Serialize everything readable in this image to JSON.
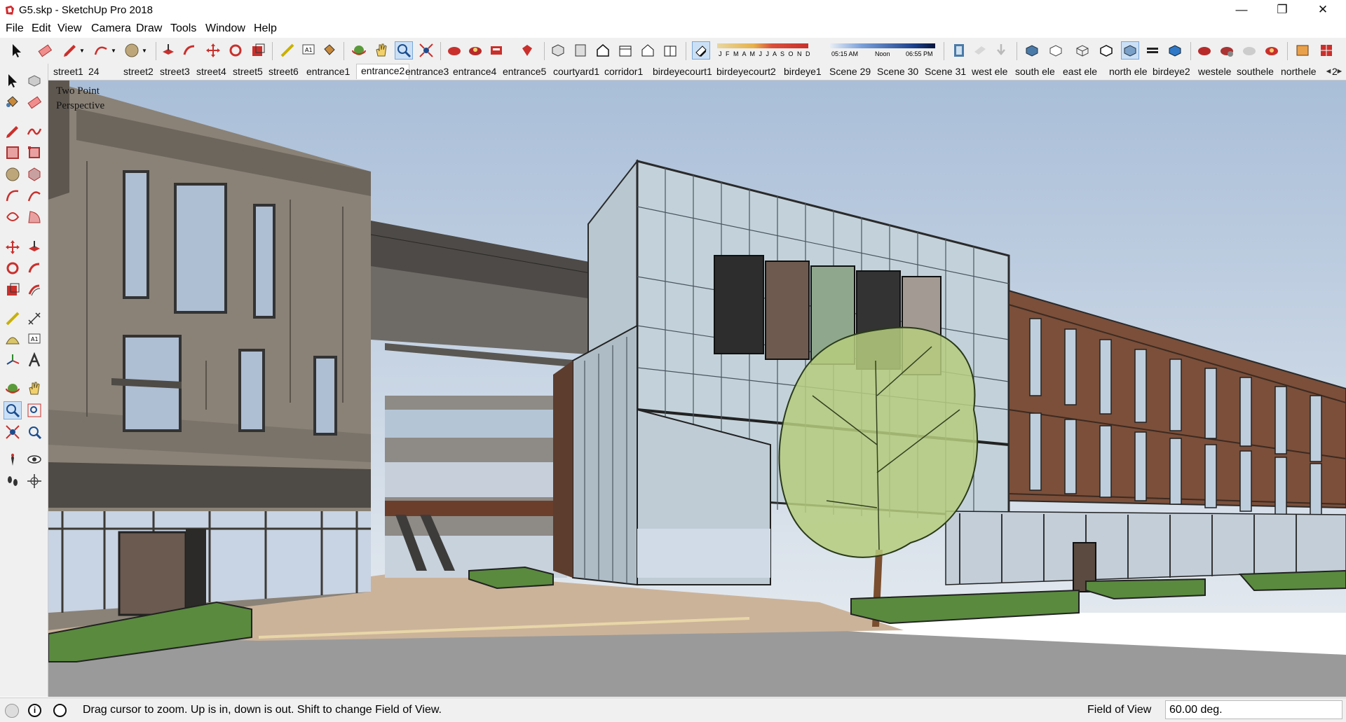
{
  "window": {
    "title": "G5.skp - SketchUp Pro 2018",
    "minimize_glyph": "—",
    "maximize_glyph": "❐",
    "close_glyph": "✕"
  },
  "menu": [
    "File",
    "Edit",
    "View",
    "Camera",
    "Draw",
    "Tools",
    "Window",
    "Help"
  ],
  "shadow_months": "J F M A M J J A S O N D",
  "time_bar": {
    "start": "05:15 AM",
    "mid": "Noon",
    "end": "06:55 PM"
  },
  "scenes": {
    "tabs": [
      "street1",
      "24",
      "street2",
      "street3",
      "street4",
      "street5",
      "street6",
      "entrance1",
      "entrance2",
      "entrance3",
      "entrance4",
      "entrance5",
      "courtyard1",
      "corridor1",
      "birdeyecourt1",
      "birdeyecourt2",
      "birdeye1",
      "Scene 29",
      "Scene 30",
      "Scene 31",
      "west ele",
      "south ele",
      "east ele",
      "north ele",
      "birdeye2",
      "westele",
      "southele",
      "northele",
      "2"
    ],
    "active": "entrance2",
    "scroll_left": "◄",
    "scroll_right": "►"
  },
  "viewport": {
    "camera_label_line1": "Two Point",
    "camera_label_line2": "Perspective"
  },
  "status": {
    "hint": "Drag cursor to zoom.  Up is in, down is out. Shift to change Field of View.",
    "measure_label": "Field of View",
    "measure_value": "60.00 deg."
  },
  "colors": {
    "sky_top": "#a9bed8",
    "sky_bottom": "#e2e8ee",
    "ground": "#8d8d8d",
    "stone_building": "#8a8277",
    "brick_building": "#7b4f3a",
    "glass": "#b8c7d0",
    "lawn": "#5a8a3e",
    "tree_canopy": "#b6cc7e",
    "red_icon": "#c9302c"
  }
}
